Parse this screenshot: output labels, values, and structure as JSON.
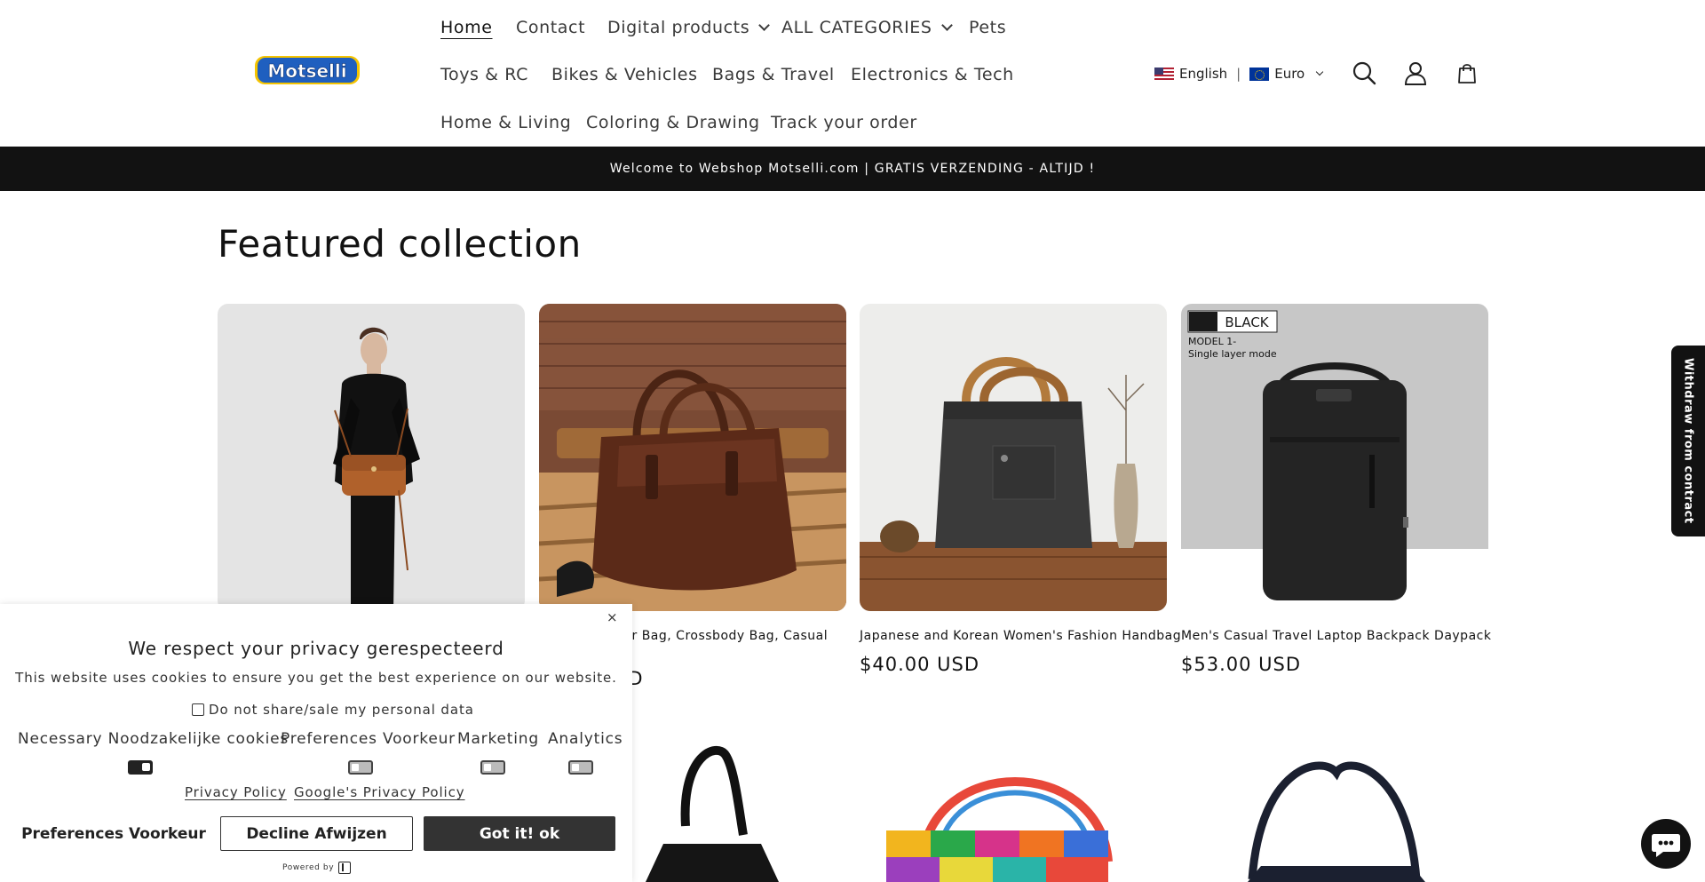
{
  "header": {
    "logo_text": "Motselli",
    "nav": [
      "Home",
      "Contact",
      "Digital products",
      "ALL CATEGORIES",
      "Pets",
      "Toys & RC",
      "Bikes & Vehicles",
      "Bags & Travel",
      "Electronics & Tech",
      "Home & Living",
      "Coloring & Drawing",
      "Track your order"
    ],
    "language": "English",
    "separator": "|",
    "currency": "Euro",
    "icons": [
      "search-icon",
      "account-icon",
      "cart-icon"
    ]
  },
  "announcement": "Welcome to Webshop Motselli.com | GRATIS VERZENDING - ALTIJD !",
  "featured": {
    "title": "Featured collection",
    "products": [
      {
        "title": "",
        "price": ""
      },
      {
        "title": "der Bag, Crossbody Bag, Casual",
        "price": "SD"
      },
      {
        "title": "Japanese and Korean Women's Fashion Handbag",
        "price": "$40.00 USD"
      },
      {
        "title": "Men's Casual Travel Laptop Backpack Daypack",
        "price": "$53.00 USD",
        "badge": "BLACK",
        "badge_sub1": "MODEL 1-",
        "badge_sub2": "Single layer mode"
      }
    ]
  },
  "side_tab": "Withdraw from contract",
  "cookie": {
    "title": "We respect your privacy gerespecteerd",
    "text": "This website uses cookies to ensure you get the best experience on our website.",
    "do_not_share": "Do not share/sale my personal data",
    "categories": [
      {
        "label": "Necessary Noodzakelijke cookies",
        "enabled": true
      },
      {
        "label": "Preferences Voorkeur",
        "enabled": false
      },
      {
        "label": "Marketing",
        "enabled": false
      },
      {
        "label": "Analytics",
        "enabled": false
      }
    ],
    "links": [
      "Privacy Policy",
      "Google's Privacy Policy"
    ],
    "buttons": {
      "preferences": "Preferences Voorkeur",
      "decline": "Decline Afwijzen",
      "accept": "Got it! ok"
    },
    "close": "×",
    "powered_by": "Powered by"
  },
  "colors": {
    "announcement_bg": "#121212",
    "text": "#121212",
    "accept_button": "#333333"
  }
}
